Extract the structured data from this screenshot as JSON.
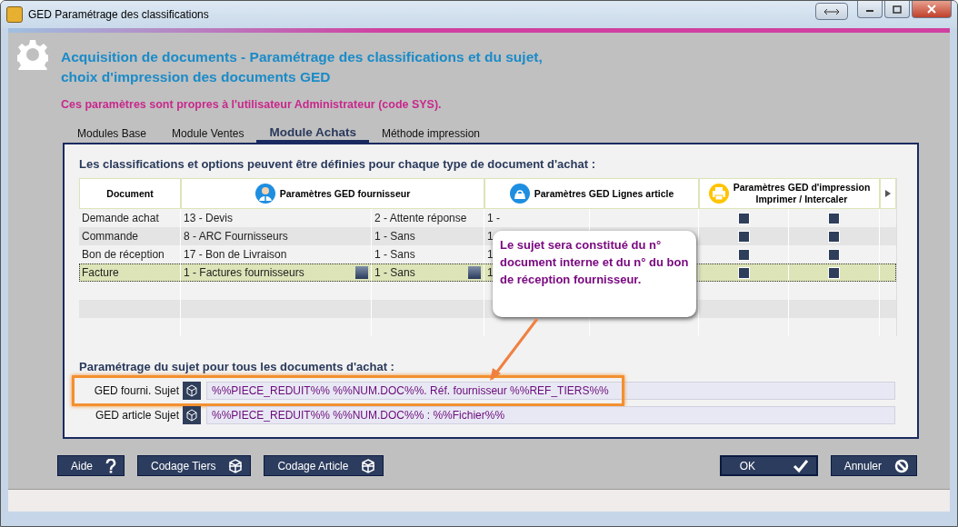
{
  "window": {
    "title": "GED Paramétrage des classifications"
  },
  "header": {
    "title_line1": "Acquisition de documents - Paramétrage des classifications et du sujet,",
    "title_line2": "choix d'impression des documents GED",
    "note": "Ces paramètres sont propres à l'utilisateur Administrateur  (code SYS)."
  },
  "tabs": [
    {
      "label": "Modules Base",
      "selected": false
    },
    {
      "label": "Module Ventes",
      "selected": false
    },
    {
      "label": "Module Achats",
      "selected": true
    },
    {
      "label": "Méthode impression",
      "selected": false
    }
  ],
  "panel": {
    "intro": "Les classifications et options peuvent être définies pour chaque type de document d'achat :"
  },
  "table": {
    "columns": [
      {
        "label": "Document",
        "kind": "plain"
      },
      {
        "label": "Paramètres GED fournisseur",
        "kind": "supplier"
      },
      {
        "label": "Paramètres GED Lignes article",
        "kind": "article"
      },
      {
        "label": "Paramètres GED d'impression\nImprimer / Intercaler",
        "kind": "print"
      }
    ],
    "rows": [
      {
        "document": "Demande achat",
        "classification": "13 - Devis",
        "state": "2 - Attente réponse",
        "article": "1 -",
        "print": true,
        "insert": true,
        "selected": false
      },
      {
        "document": "Commande",
        "classification": "8 - ARC Fournisseurs",
        "state": "1 - Sans",
        "article": "1",
        "print": true,
        "insert": true,
        "selected": false
      },
      {
        "document": "Bon de réception",
        "classification": "17 - Bon de Livraison",
        "state": "1 - Sans",
        "article": "1",
        "print": true,
        "insert": true,
        "selected": false
      },
      {
        "document": "Facture",
        "classification": "1 - Factures fournisseurs",
        "state": "1 - Sans",
        "article": "1",
        "print": true,
        "insert": true,
        "selected": true
      }
    ]
  },
  "subject": {
    "title": "Paramétrage du sujet pour tous les documents d'achat :",
    "fields": [
      {
        "label": "GED fourni. Sujet",
        "value": "%%PIECE_REDUIT%% %%NUM.DOC%%.  Réf. fournisseur %%REF_TIERS%%",
        "highlighted": true
      },
      {
        "label": "GED article Sujet",
        "value": "%%PIECE_REDUIT%% %%NUM.DOC%% : %%Fichier%%",
        "highlighted": false
      }
    ]
  },
  "callout": {
    "text": "Le sujet sera constitué du n° document interne et du n° du bon de réception fournisseur."
  },
  "buttons_left": [
    {
      "label": "Aide",
      "kind": "help"
    },
    {
      "label": "Codage Tiers",
      "kind": "code"
    },
    {
      "label": "Codage Article",
      "kind": "code"
    }
  ],
  "buttons_right": [
    {
      "label": "OK",
      "kind": "ok"
    },
    {
      "label": "Annuler",
      "kind": "cancel"
    }
  ]
}
